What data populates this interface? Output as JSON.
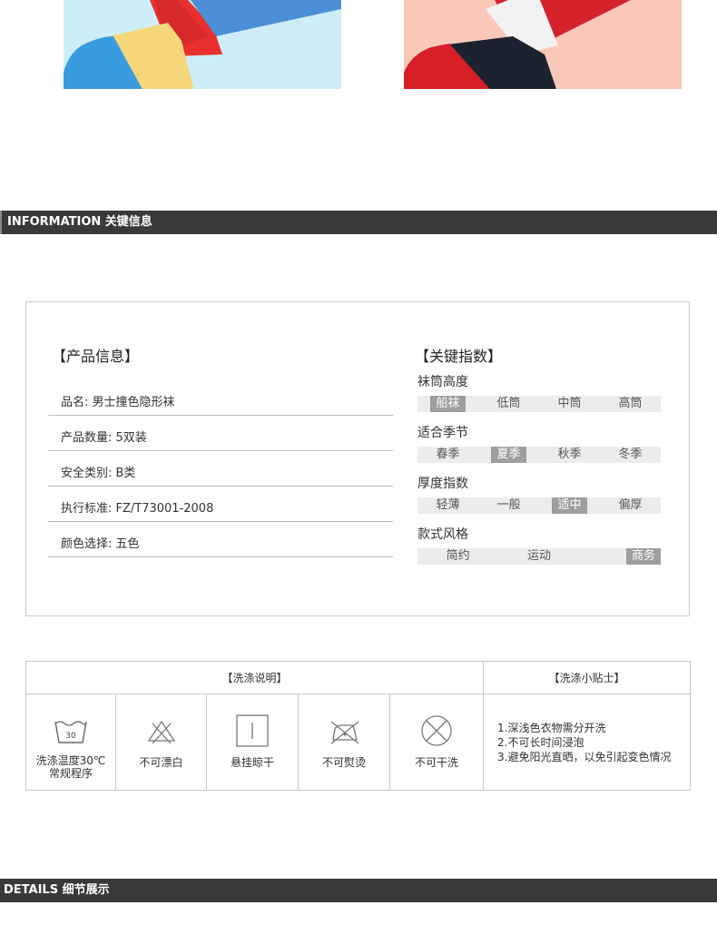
{
  "images": {
    "left_sock_alt": "blue yellow red sock",
    "right_sock_alt": "red navy white sock"
  },
  "sections": {
    "information": "INFORMATION 关键信息",
    "details": "DETAILS  细节展示"
  },
  "product_info": {
    "title": "【产品信息】",
    "rows": [
      "品名: 男士撞色隐形袜",
      "产品数量: 5双装",
      "安全类别: B类",
      "执行标准: FZ/T73001-2008",
      "颜色选择: 五色"
    ]
  },
  "key_index": {
    "title": "【关键指数】",
    "groups": [
      {
        "label": "袜筒高度",
        "options": [
          "船袜",
          "低筒",
          "中筒",
          "高筒"
        ],
        "selected": 0
      },
      {
        "label": "适合季节",
        "options": [
          "春季",
          "夏季",
          "秋季",
          "冬季"
        ],
        "selected": 1
      },
      {
        "label": "厚度指数",
        "options": [
          "轻薄",
          "一般",
          "适中",
          "偏厚"
        ],
        "selected": 2
      },
      {
        "label": "款式风格",
        "options": [
          "简约",
          "运动",
          "商务"
        ],
        "selected": 2
      }
    ]
  },
  "washing": {
    "header": "【洗涤说明】",
    "tips_header": "【洗涤小贴士】",
    "icons": [
      {
        "icon": "wash-30-icon",
        "label": "洗涤温度30℃\n常规程序",
        "num": "30"
      },
      {
        "icon": "no-bleach-icon",
        "label": "不可漂白"
      },
      {
        "icon": "hang-dry-icon",
        "label": "悬挂晾干"
      },
      {
        "icon": "no-iron-icon",
        "label": "不可熨烫"
      },
      {
        "icon": "no-dry-clean-icon",
        "label": "不可干洗"
      }
    ],
    "tips": [
      "1.深浅色衣物需分开洗",
      "2.不可长时间浸泡",
      "3.避免阳光直晒，以免引起变色情况"
    ]
  },
  "colors": {
    "bar": "#393939",
    "selected": "#9e9e9e",
    "option_bg": "#ececec"
  }
}
